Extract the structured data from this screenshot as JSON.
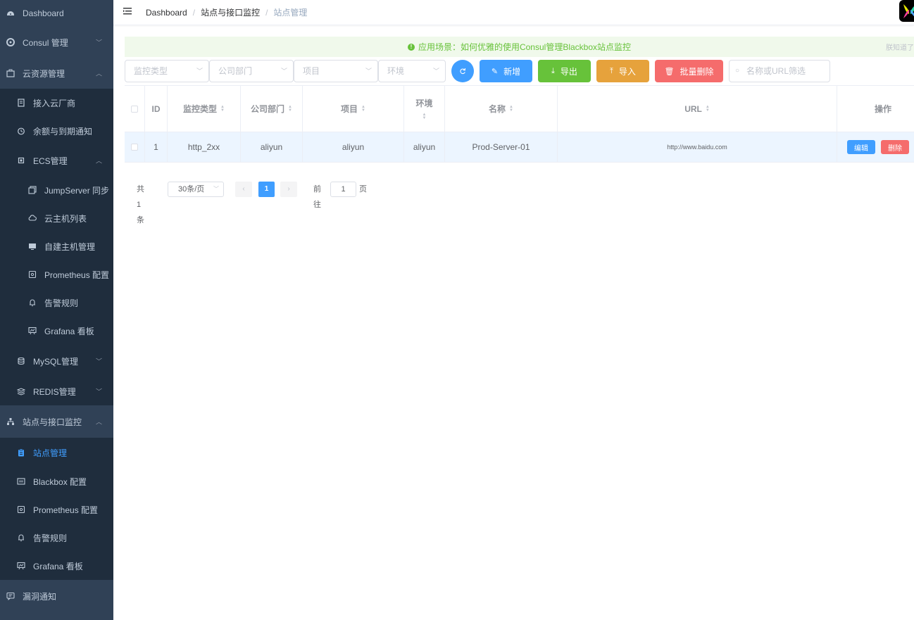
{
  "sidebar": {
    "items": [
      {
        "label": "Dashboard",
        "icon": "dashboard-icon"
      },
      {
        "label": "Consul 管理",
        "icon": "consul-icon"
      },
      {
        "label": "云资源管理",
        "icon": "briefcase-icon"
      },
      {
        "label": "接入云厂商",
        "icon": "document-icon"
      },
      {
        "label": "余额与到期通知",
        "icon": "alarm-clock-icon"
      },
      {
        "label": "ECS管理",
        "icon": "cpu-icon"
      },
      {
        "label": "JumpServer 同步",
        "icon": "copy-icon"
      },
      {
        "label": "云主机列表",
        "icon": "cloud-icon"
      },
      {
        "label": "自建主机管理",
        "icon": "monitor-icon"
      },
      {
        "label": "Prometheus 配置",
        "icon": "config-icon"
      },
      {
        "label": "告警规则",
        "icon": "bell-icon"
      },
      {
        "label": "Grafana 看板",
        "icon": "chart-board-icon"
      },
      {
        "label": "MySQL管理",
        "icon": "database-icon"
      },
      {
        "label": "REDIS管理",
        "icon": "redis-icon"
      },
      {
        "label": "站点与接口监控",
        "icon": "sitemap-icon"
      },
      {
        "label": "站点管理",
        "icon": "clipboard-icon"
      },
      {
        "label": "Blackbox 配置",
        "icon": "blackbox-icon"
      },
      {
        "label": "Prometheus 配置",
        "icon": "config-icon"
      },
      {
        "label": "告警规则",
        "icon": "bell-icon"
      },
      {
        "label": "Grafana 看板",
        "icon": "chart-board-icon"
      },
      {
        "label": "漏洞通知",
        "icon": "message-icon"
      }
    ]
  },
  "header": {
    "breadcrumb": [
      "Dashboard",
      "站点与接口监控",
      "站点管理"
    ]
  },
  "notice": {
    "text": "应用场景：如何优雅的使用Consul管理Blackbox站点监控",
    "close_text": "朕知道了"
  },
  "filters": {
    "monitor_type": "监控类型",
    "department": "公司部门",
    "project": "项目",
    "environment": "环境",
    "search_placeholder": "名称或URL筛选"
  },
  "buttons": {
    "add": "新增",
    "export": "导出",
    "import": "导入",
    "batch_delete": "批量删除",
    "edit": "编辑",
    "delete": "删除"
  },
  "table": {
    "columns": [
      "ID",
      "监控类型",
      "公司部门",
      "项目",
      "环境",
      "名称",
      "URL",
      "操作"
    ],
    "rows": [
      {
        "id": "1",
        "type": "http_2xx",
        "department": "aliyun",
        "project": "aliyun",
        "env": "aliyun",
        "name": "Prod-Server-01",
        "url": "http://www.baidu.com"
      }
    ]
  },
  "pagination": {
    "total": "共 1 条",
    "page_size": "30条/页",
    "current": "1",
    "goto_label": "前往",
    "goto_value": "1",
    "page_suffix": "页"
  },
  "colors": {
    "sidebar_bg": "#304156",
    "submenu_bg": "#1f2d3d",
    "primary": "#409eff",
    "success": "#67c23a",
    "warning": "#e6a23c",
    "danger": "#f56c6c"
  }
}
